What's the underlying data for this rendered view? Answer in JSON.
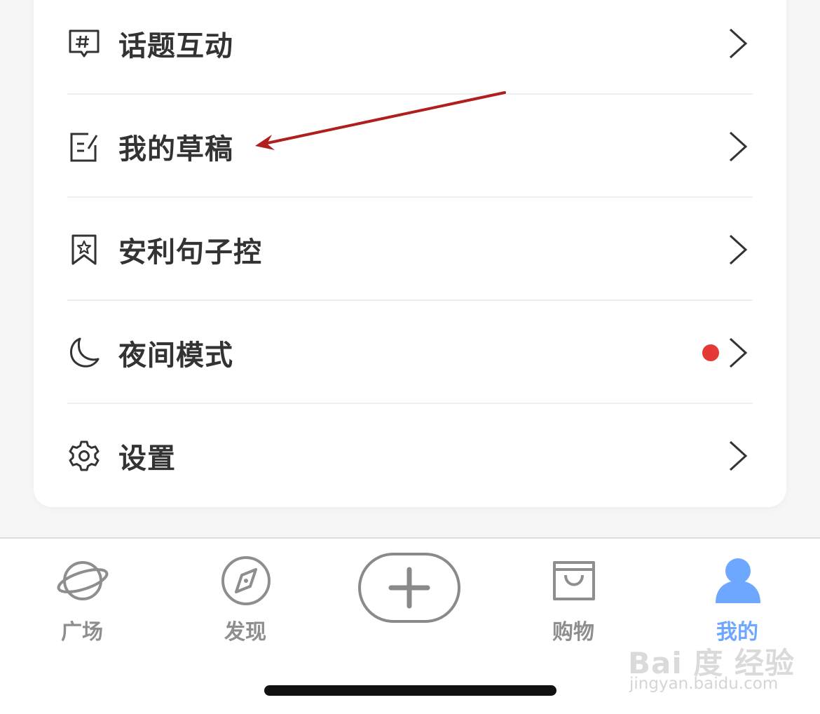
{
  "menu": {
    "items": [
      {
        "label": "话题互动",
        "icon": "topic-hash-icon"
      },
      {
        "label": "我的草稿",
        "icon": "draft-edit-icon"
      },
      {
        "label": "安利句子控",
        "icon": "bookmark-star-icon"
      },
      {
        "label": "夜间模式",
        "icon": "moon-icon",
        "badge": "red-dot"
      },
      {
        "label": "设置",
        "icon": "gear-icon"
      }
    ]
  },
  "tabbar": {
    "tabs": [
      {
        "label": "广场",
        "icon": "planet-icon"
      },
      {
        "label": "发现",
        "icon": "compass-icon"
      },
      {
        "label": "",
        "icon": "plus-icon"
      },
      {
        "label": "购物",
        "icon": "shopping-bag-icon"
      },
      {
        "label": "我的",
        "icon": "person-icon",
        "active": true
      }
    ]
  },
  "watermark": {
    "brand": "Bai 度 经验",
    "url": "jingyan.baidu.com"
  },
  "colors": {
    "accent": "#6ea7ff",
    "badge": "#e53935",
    "annotation_arrow": "#b01e1e",
    "text": "#333333",
    "tab_inactive": "#8e8e8e"
  }
}
